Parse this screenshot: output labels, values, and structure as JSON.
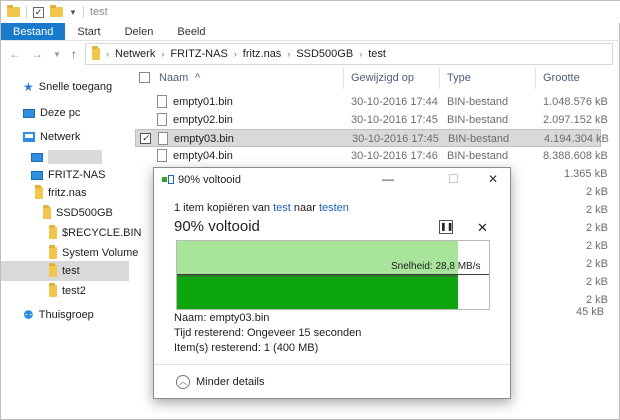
{
  "window": {
    "title": "test"
  },
  "ribbon": {
    "tabs": [
      "Bestand",
      "Start",
      "Delen",
      "Beeld"
    ]
  },
  "breadcrumb": [
    "Netwerk",
    "FRITZ-NAS",
    "fritz.nas",
    "SSD500GB",
    "test"
  ],
  "sidebar": {
    "quick_access": "Snelle toegang",
    "this_pc": "Deze pc",
    "network": "Netwerk",
    "fritz_nas": "FRITZ-NAS",
    "fritz_nas_host": "fritz.nas",
    "ssd": "SSD500GB",
    "recycle": "$RECYCLE.BIN",
    "system_volume": "System Volume",
    "test": "test",
    "test2": "test2",
    "homegroup": "Thuisgroep"
  },
  "list": {
    "columns": {
      "name": "Naam",
      "modified": "Gewijzigd op",
      "type": "Type",
      "size": "Grootte"
    },
    "rows": [
      {
        "name": "empty01.bin",
        "modified": "30-10-2016 17:44",
        "type": "BIN-bestand",
        "size": "1.048.576 kB"
      },
      {
        "name": "empty02.bin",
        "modified": "30-10-2016 17:45",
        "type": "BIN-bestand",
        "size": "2.097.152 kB"
      },
      {
        "name": "empty03.bin",
        "modified": "30-10-2016 17:45",
        "type": "BIN-bestand",
        "size": "4.194.304 kB"
      },
      {
        "name": "empty04.bin",
        "modified": "30-10-2016 17:46",
        "type": "BIN-bestand",
        "size": "8.388.608 kB"
      }
    ],
    "extra_sizes": [
      "1.365 kB",
      "2 kB",
      "2 kB",
      "2 kB",
      "2 kB",
      "2 kB",
      "2 kB",
      "2 kB",
      "45 kB"
    ]
  },
  "dialog": {
    "title": "90% voltooid",
    "line_prefix": "1 item kopiëren van ",
    "from": "test",
    "line_middle": " naar ",
    "to": "testen",
    "heading": "90% voltooid",
    "progress_fraction": 0.9,
    "speed_label": "Snelheid: 28,8 MB/s",
    "name_line": "Naam: empty03.bin",
    "time_line": "Tijd resterend: Ongeveer 15 seconden",
    "items_line": "Item(s) resterend: 1 (400 MB)",
    "less_details": "Minder details",
    "colors": {
      "graph_light": "#a8e59a",
      "graph_dark": "#0ea60e"
    }
  }
}
